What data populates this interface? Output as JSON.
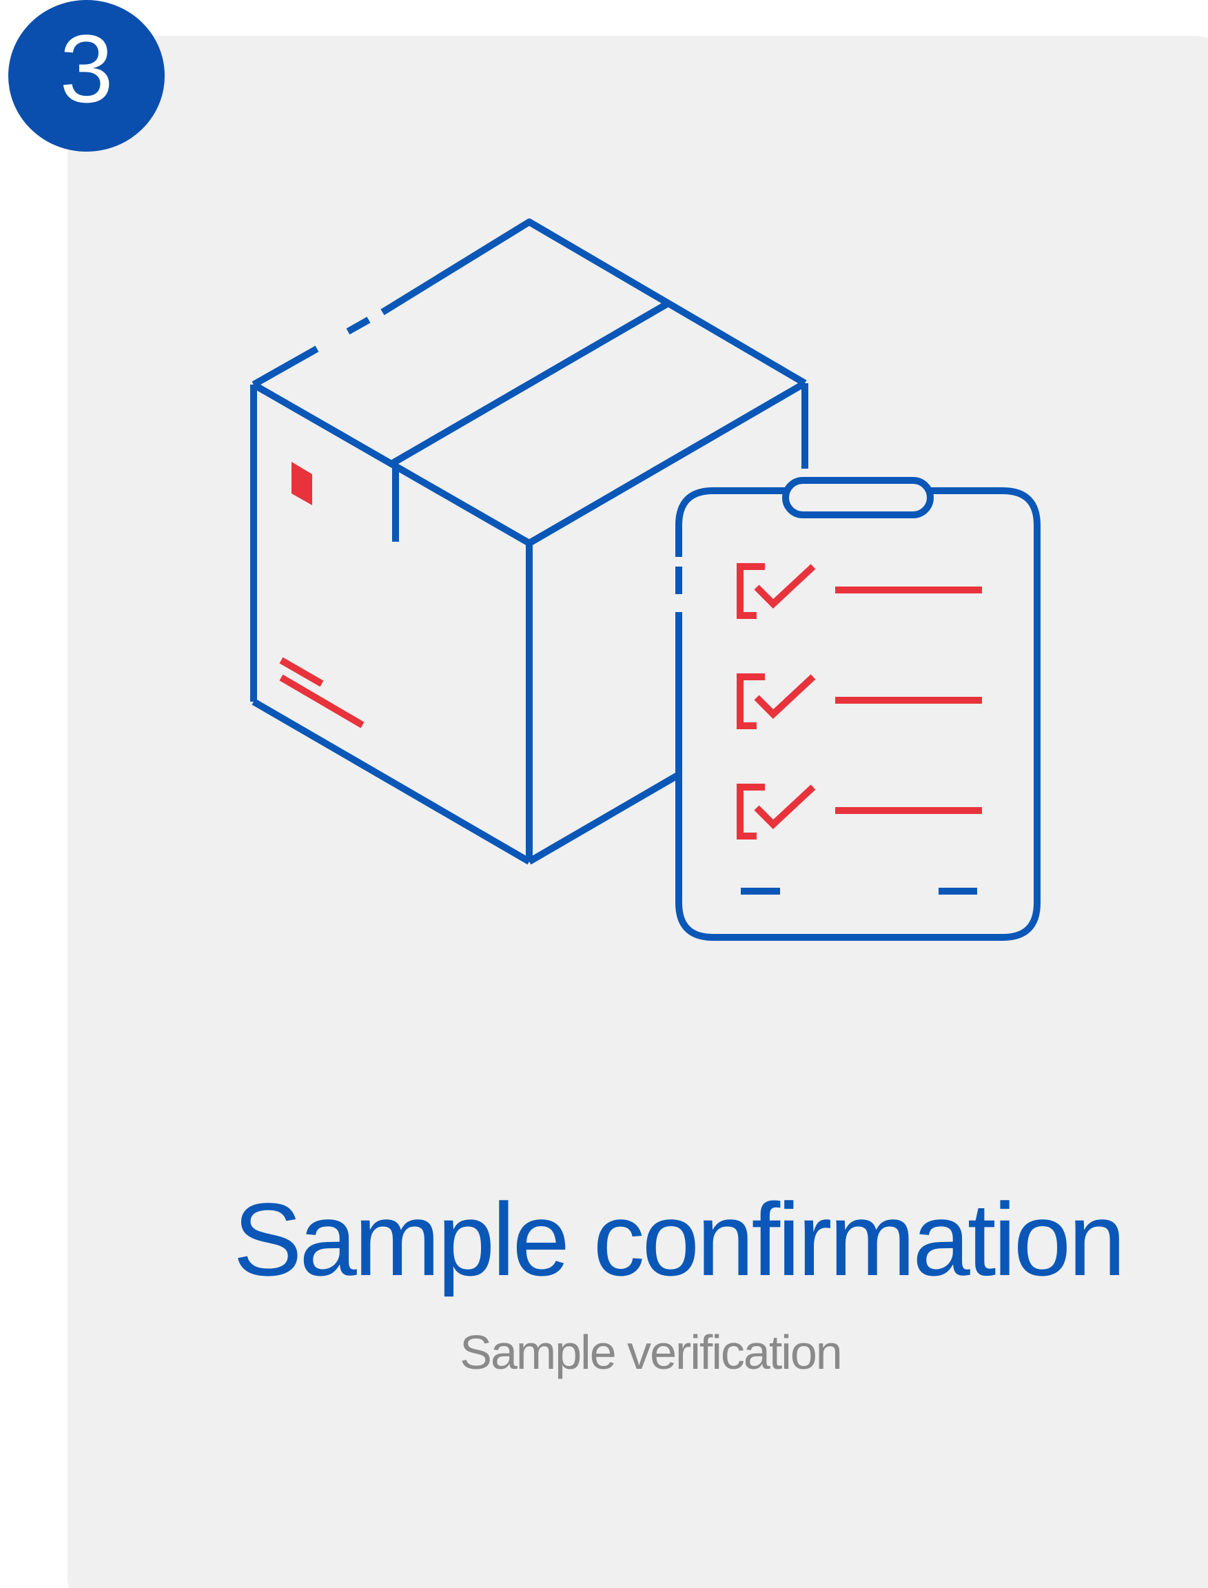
{
  "step": {
    "number": "3"
  },
  "card": {
    "title": "Sample confirmation",
    "subtitle": "Sample verification"
  },
  "illustration": {
    "icons": [
      "package-box-icon",
      "checklist-clipboard-icon"
    ],
    "checklist_item_count": 3
  },
  "colors": {
    "primary_blue": "#0a57b8",
    "accent_red": "#e8333c",
    "card_background": "#f0f0f0",
    "subtitle_gray": "#8a8a8a"
  }
}
